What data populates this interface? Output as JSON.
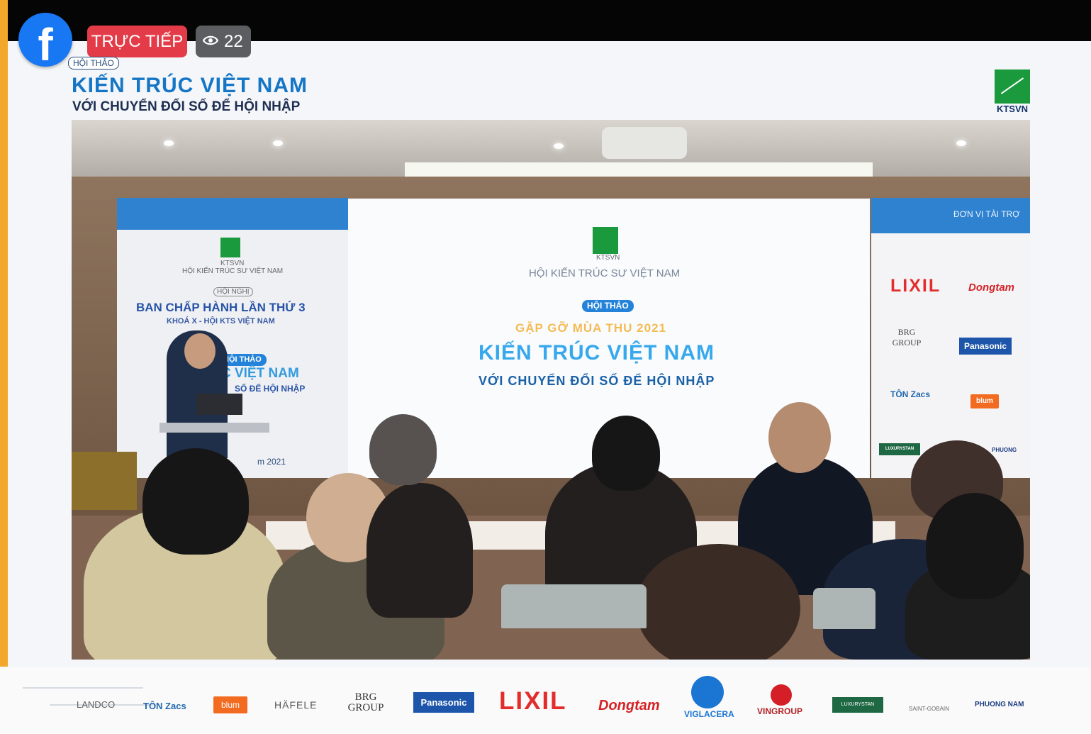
{
  "overlay": {
    "live_label": "TRỰC TIẾP",
    "viewer_count": "22",
    "facebook_icon": "facebook-logo-icon",
    "eye_icon": "eye-icon"
  },
  "event": {
    "tag": "HỘI THẢO",
    "title": "KIẾN TRÚC VIỆT NAM",
    "subtitle": "VỚI CHUYỂN ĐỔI SỐ ĐỂ HỘI NHẬP",
    "logo_text": "KTSVN"
  },
  "stage": {
    "left_banner": {
      "logo_text": "KTSVN",
      "org": "HỘI KIẾN TRÚC SƯ VIỆT NAM",
      "tag": "HỘI NGHỊ",
      "title": "BAN CHẤP HÀNH LẦN THỨ 3",
      "subtitle": "KHOÁ X - HỘI KTS VIỆT NAM",
      "event_tag": "HỘI THẢO",
      "event_title": "C VIỆT NAM",
      "event_subtitle": "SỐ ĐỂ HỘI NHẬP",
      "date": "m 2021"
    },
    "screen": {
      "logo_text": "KTSVN",
      "org": "HỘI KIẾN TRÚC SƯ VIỆT NAM",
      "tag": "HỘI THẢO",
      "year_title": "GẶP GỠ MÙA THU 2021",
      "title": "KIẾN TRÚC VIỆT NAM",
      "subtitle": "VỚI CHUYỂN ĐỔI SỐ ĐỂ HỘI NHẬP"
    },
    "right_banner": {
      "header": "ĐƠN VỊ TÀI TRỢ",
      "sponsors": [
        "LIXIL",
        "Dongtam",
        "BRG GROUP",
        "Panasonic",
        "TÔN Zacs",
        "blum",
        "LUXURYSTAN",
        "PHUONG"
      ]
    }
  },
  "bottom_sponsors": [
    "LANDCO",
    "TÔN Zacs",
    "blum",
    "HÄFELE",
    "BRG GROUP",
    "Panasonic",
    "LIXIL",
    "Dongtam",
    "VIGLACERA",
    "VINGROUP",
    "LUXURYSTAN",
    "SAINT-GOBAIN",
    "PHUONG NAM"
  ],
  "colors": {
    "facebook_blue": "#1877f2",
    "live_red": "#e33c48",
    "event_blue": "#1676c6",
    "ktsvn_green": "#1b9a3d",
    "edge_orange": "#f3a72b"
  }
}
